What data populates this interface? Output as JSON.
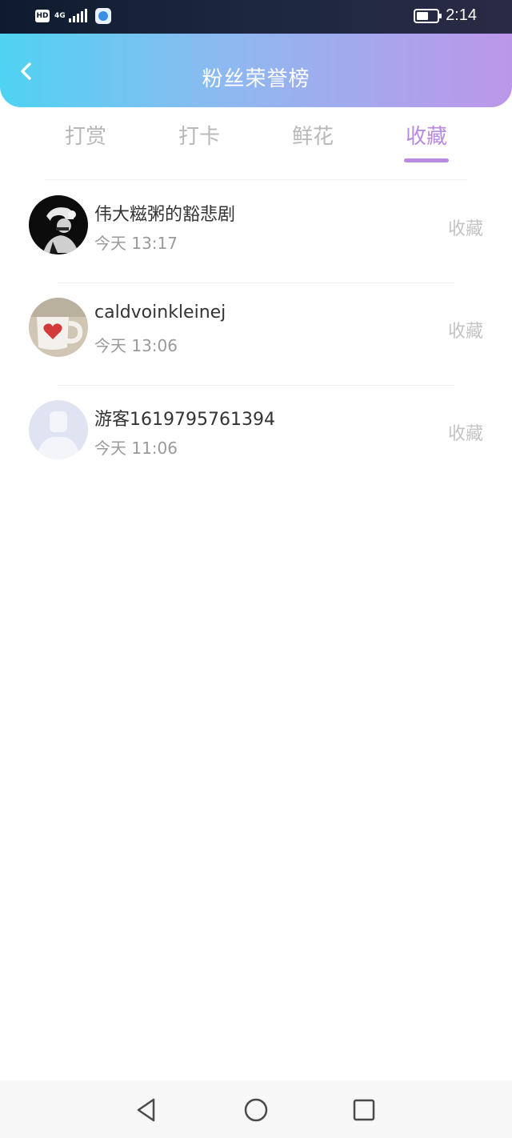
{
  "status_bar": {
    "hd_label": "HD",
    "network_label": "4G",
    "time": "2:14"
  },
  "header": {
    "title": "粉丝荣誉榜",
    "back_icon": "chevron-left-icon"
  },
  "tabs": [
    {
      "label": "打赏",
      "active": false
    },
    {
      "label": "打卡",
      "active": false
    },
    {
      "label": "鲜花",
      "active": false
    },
    {
      "label": "收藏",
      "active": true
    }
  ],
  "list": [
    {
      "name": "伟大糍粥的豁悲剧",
      "time": "今天 13:17",
      "action": "收藏",
      "avatar": "mario-silhouette"
    },
    {
      "name": "caldvoinkleinej",
      "time": "今天 13:06",
      "action": "收藏",
      "avatar": "heart-mug"
    },
    {
      "name": "游客1619795761394",
      "time": "今天 11:06",
      "action": "收藏",
      "avatar": "default-user"
    }
  ],
  "colors": {
    "accent": "#b88ae0",
    "header_gradient_start": "#4fd3f2",
    "header_gradient_end": "#bd96ea",
    "inactive_tab": "#b8b8b8"
  },
  "nav_bar": {
    "back_icon": "triangle-back-icon",
    "home_icon": "circle-home-icon",
    "recents_icon": "square-recents-icon"
  }
}
